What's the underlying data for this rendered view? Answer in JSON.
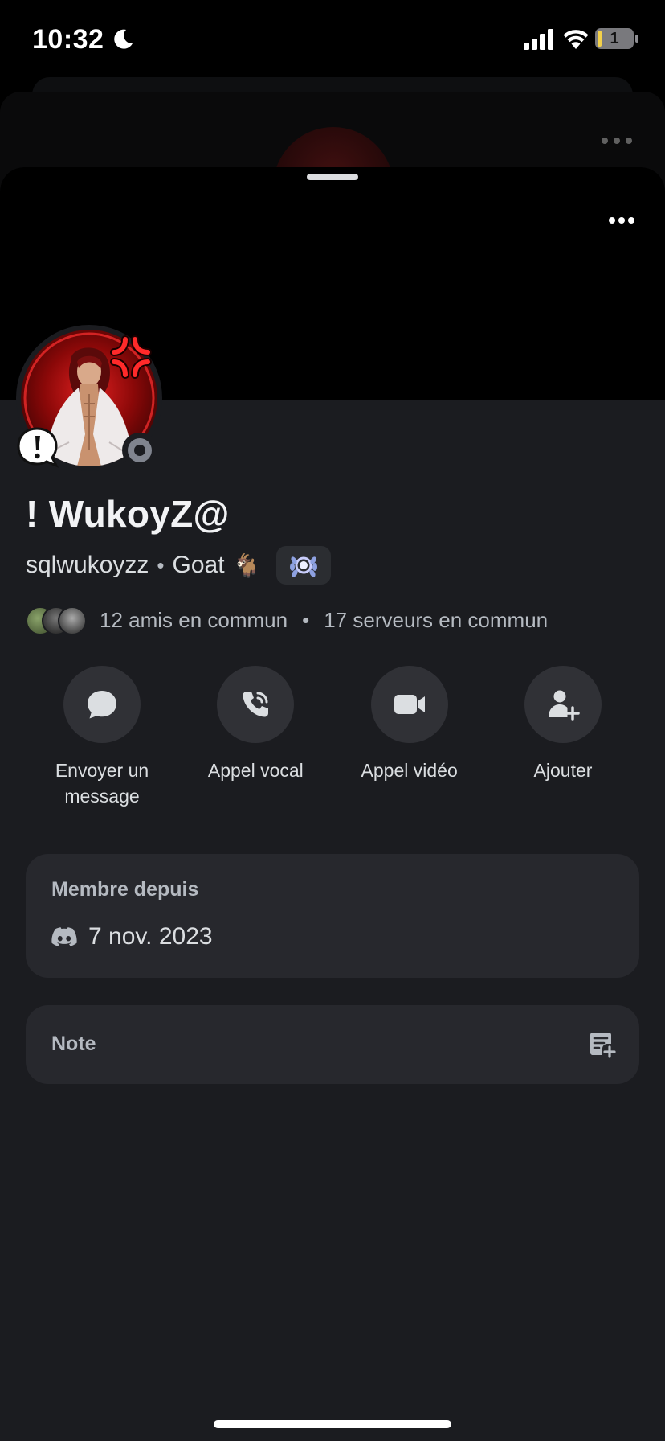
{
  "status_bar": {
    "time": "10:32",
    "battery_level": "1"
  },
  "profile": {
    "display_name": "! WukoyZ@",
    "username": "sqlwukoyzz",
    "separator": "•",
    "custom_status": "Goat",
    "status_emoji": "🐐",
    "presence": "offline"
  },
  "mutuals": {
    "friends": "12 amis en commun",
    "separator": "•",
    "servers": "17 serveurs en commun"
  },
  "actions": [
    {
      "label": "Envoyer un message",
      "icon": "chat-bubble-icon"
    },
    {
      "label": "Appel vocal",
      "icon": "phone-call-icon"
    },
    {
      "label": "Appel vidéo",
      "icon": "video-camera-icon"
    },
    {
      "label": "Ajouter",
      "icon": "add-friend-icon"
    }
  ],
  "member_since": {
    "title": "Membre depuis",
    "date": "7 nov. 2023"
  },
  "note": {
    "title": "Note"
  },
  "colors": {
    "sheet_bg": "#1b1c20",
    "card_bg": "#27282d",
    "action_bg": "#303136",
    "accent_red": "#d11a1a",
    "offline": "#80848e"
  }
}
